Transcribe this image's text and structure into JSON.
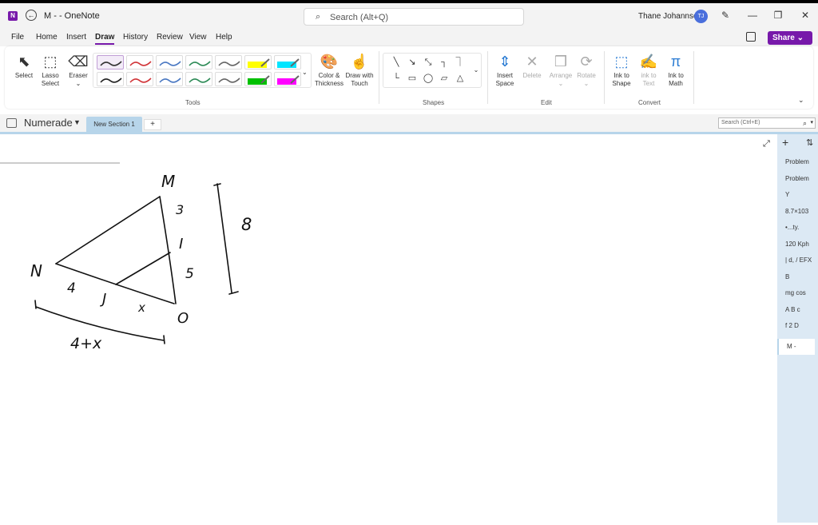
{
  "window": {
    "title": "M -  - OneNote",
    "search_placeholder": "Search (Alt+Q)",
    "user_name": "Thane Johannsen",
    "user_initials": "TJ"
  },
  "menu": [
    "File",
    "Home",
    "Insert",
    "Draw",
    "History",
    "Review",
    "View",
    "Help"
  ],
  "menu_active": "Draw",
  "share_label": "Share",
  "ribbon": {
    "tools": {
      "select": "Select",
      "lasso": [
        "Lasso",
        "Select"
      ],
      "eraser": "Eraser",
      "color_thickness": [
        "Color &",
        "Thickness"
      ],
      "draw_touch": [
        "Draw with",
        "Touch"
      ],
      "label": "Tools"
    },
    "pen_colors": [
      "#333333",
      "#d13438",
      "#4a78c2",
      "#2e8b57",
      "#666666",
      "#ffff00",
      "#00e5ff",
      "#222222",
      "#d13438",
      "#4a78c2",
      "#2e8b57",
      "#666666",
      "#00c000",
      "#ff00ff"
    ],
    "shapes_label": "Shapes",
    "edit": {
      "insert_space": [
        "Insert",
        "Space"
      ],
      "delete": "Delete",
      "arrange": "Arrange",
      "rotate": "Rotate",
      "label": "Edit"
    },
    "convert": {
      "ink_to_shape": [
        "Ink to",
        "Shape"
      ],
      "ink_to_text": [
        "ink to",
        "Text"
      ],
      "ink_to_math": [
        "Ink to",
        "Math"
      ],
      "label": "Convert"
    }
  },
  "notebook": {
    "name": "Numerade",
    "section_tab": "New Section 1",
    "add_section": "+",
    "page_search_placeholder": "Search (Ctrl+E)"
  },
  "pages": [
    "Problem",
    "Problem",
    "Y",
    "8.7×103",
    "•...ty.",
    "120 Kph",
    "| d, / EFX",
    "B",
    "mg cos",
    "A B c",
    "f 2 D",
    "M -"
  ],
  "current_page": "M -",
  "ink": {
    "vertex_m": "M",
    "vertex_n": "N",
    "vertex_o": "O",
    "point_i": "I",
    "point_j": "J",
    "len_mi": "3",
    "len_io": "5",
    "len_mo": "8",
    "len_nj": "4",
    "len_jo": "x",
    "len_no": "4+x"
  }
}
